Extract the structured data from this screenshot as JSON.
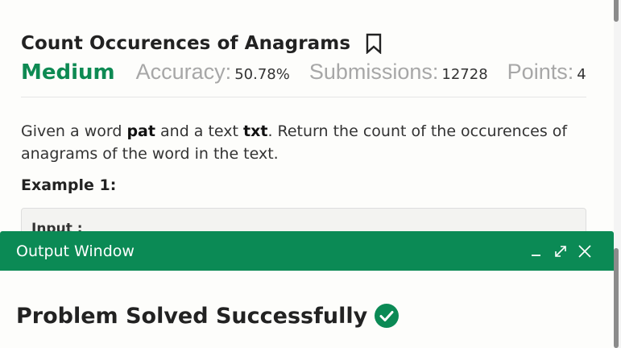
{
  "problem": {
    "title": "Count Occurences of Anagrams",
    "bookmark_icon": "bookmark-icon",
    "difficulty": "Medium",
    "accuracy_label": "Accuracy:",
    "accuracy_value": "50.78%",
    "submissions_label": "Submissions:",
    "submissions_value": "12728",
    "points_label": "Points:",
    "points_value": "4",
    "description": {
      "part1": "Given a word ",
      "bold1": "pat",
      "part2": " and a text ",
      "bold2": "txt",
      "part3": ". Return the count of the occurences of anagrams of the word in the text."
    },
    "example_label": "Example 1:",
    "example_input_label": "Input :"
  },
  "output_window": {
    "title": "Output Window",
    "icons": [
      "minimize-icon",
      "expand-icon",
      "close-icon"
    ],
    "status_text": "Problem Solved Successfully",
    "status_icon": "check-circle-icon"
  },
  "colors": {
    "brand_green": "#0b8a55",
    "difficulty_green": "#0e8a53",
    "muted_label": "#a7a7a7"
  }
}
